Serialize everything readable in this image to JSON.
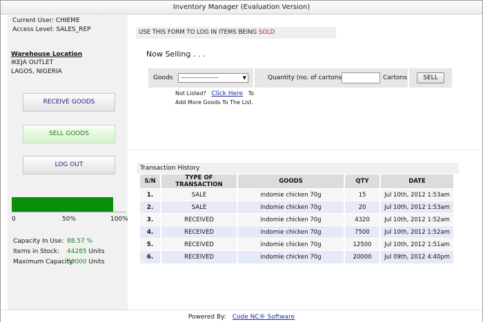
{
  "window": {
    "title": "Inventory Manager (Evaluation Version)"
  },
  "user": {
    "current_user": "Current User: CHIEME",
    "access_level": "Access Level: SALES_REP"
  },
  "warehouse": {
    "heading": "Warehouse Location",
    "name": "IKEJA OUTLET",
    "city": "LAGOS, NIGERIA"
  },
  "nav": {
    "receive": "RECEIVE GOODS",
    "sell": "SELL GOODS",
    "logout": "LOG OUT"
  },
  "capacity_bar": {
    "fill_fraction": 0.8857,
    "tick_0": "0",
    "tick_50": "50%",
    "tick_100": "100%"
  },
  "stats": {
    "capacity_label": "Capacity In Use:",
    "capacity_value": "88.57 %",
    "items_label": "Items in Stock:",
    "items_value": "44285",
    "items_unit": "Units",
    "max_label": "Maximum Capacity:",
    "max_value": "50000",
    "max_unit": "Units"
  },
  "form": {
    "notice_prefix": "USE THIS FORM TO LOG IN ITEMS BEING",
    "notice_highlight": "SOLD",
    "heading": "Now Selling . . .",
    "goods_label": "Goods",
    "goods_selected": "-------------------",
    "qty_label": "Quantity (no. of cartons)",
    "qty_value": "",
    "cartons_label": "Cartons",
    "sell_button": "SELL",
    "not_listed": "Not Listed?",
    "click_here": "Click Here",
    "to": "To",
    "add_more": "Add More Goods To The List."
  },
  "transactions": {
    "title": "Transaction History",
    "columns": [
      "S/N",
      "TYPE OF TRANSACTION",
      "GOODS",
      "QTY",
      "DATE"
    ],
    "rows": [
      [
        "1.",
        "SALE",
        "indomie chicken 70g",
        "15",
        "Jul 10th, 2012 1:53am"
      ],
      [
        "2.",
        "SALE",
        "indomie chicken 70g",
        "20",
        "Jul 10th, 2012 1:53am"
      ],
      [
        "3.",
        "RECEIVED",
        "indomie chicken 70g",
        "4320",
        "Jul 10th, 2012 1:52am"
      ],
      [
        "4.",
        "RECEIVED",
        "indomie chicken 70g",
        "7500",
        "Jul 10th, 2012 1:52am"
      ],
      [
        "5.",
        "RECEIVED",
        "indomie chicken 70g",
        "12500",
        "Jul 10th, 2012 1:51am"
      ],
      [
        "6.",
        "RECEIVED",
        "indomie chicken 70g",
        "20000",
        "Jul 09th, 2012 4:40pm"
      ]
    ]
  },
  "footer": {
    "powered_by": "Powered By:",
    "link": "Code NC® Software"
  },
  "colors": {
    "accent_green": "#0b8f0b",
    "highlight_red": "#d61515",
    "link_blue": "#1a2a9a"
  }
}
